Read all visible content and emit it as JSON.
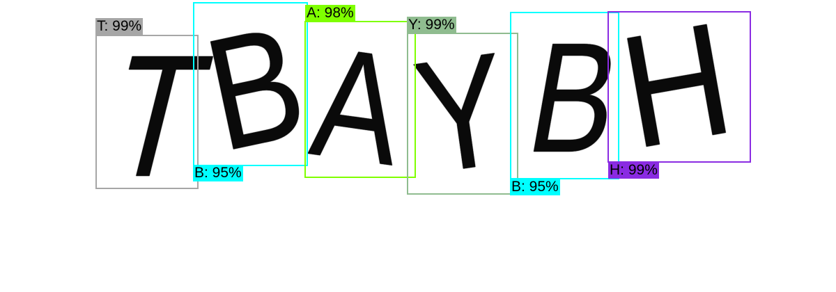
{
  "detections": [
    {
      "glyph": "T",
      "label": "T: 99%",
      "color": "#a6a6a6"
    },
    {
      "glyph": "B",
      "label": "B: 95%",
      "color": "#00ffff"
    },
    {
      "glyph": "A",
      "label": "A: 98%",
      "color": "#7fff00"
    },
    {
      "glyph": "Y",
      "label": "Y: 99%",
      "color": "#8fbc8f"
    },
    {
      "glyph": "B",
      "label": "B: 95%",
      "color": "#00ffff"
    },
    {
      "glyph": "H",
      "label": "H: 99%",
      "color": "#8a2be2"
    }
  ]
}
